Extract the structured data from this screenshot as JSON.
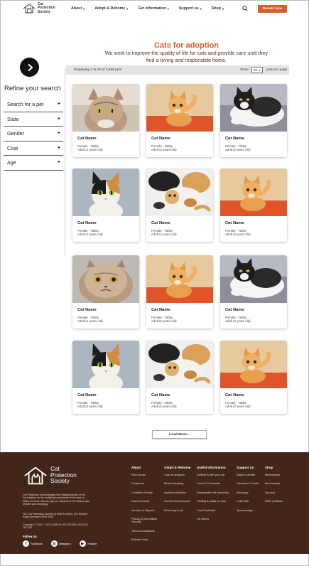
{
  "header": {
    "logo_lines": [
      "Cat",
      "Protection",
      "Society"
    ],
    "nav": [
      {
        "label": "About"
      },
      {
        "label": "Adopt & Rehome"
      },
      {
        "label": "Get information"
      },
      {
        "label": "Support us"
      },
      {
        "label": "Shop"
      }
    ],
    "search_icon": "search-icon",
    "donate_label": "Donate now"
  },
  "page": {
    "title": "Cats for adoption",
    "subtitle": "We work to improve the quality of life for cats and provide care until they find a loving and responsible home."
  },
  "sidebar": {
    "refine_title": "Refine your search",
    "filters": [
      {
        "label": "Search for a pet",
        "icon": "plus-icon"
      },
      {
        "label": "State",
        "icon": "plus-icon"
      },
      {
        "label": "Gender",
        "icon": "plus-icon"
      },
      {
        "label": "Coat",
        "icon": "plus-icon"
      },
      {
        "label": "Age",
        "icon": "plus-icon"
      }
    ]
  },
  "results": {
    "count_text": "Displaying 1 to 20 of 3,959 pets",
    "show_label": "Show",
    "show_value": "20",
    "per_page_label": "pets per page"
  },
  "pets": [
    {
      "name": "Cat Name",
      "gender_coat": "Female - Tabby",
      "age": "Adult (2 years old)",
      "photo": "tabby"
    },
    {
      "name": "Cat Name",
      "gender_coat": "Female - Tabby",
      "age": "Adult (2 years old)",
      "photo": "kitten-orange"
    },
    {
      "name": "Cat Name",
      "gender_coat": "Female - Tabby",
      "age": "Adult (2 years old)",
      "photo": "black-white"
    },
    {
      "name": "Cat Name",
      "gender_coat": "Female - Tabby",
      "age": "Adult (2 years old)",
      "photo": "calico"
    },
    {
      "name": "Cat Name",
      "gender_coat": "Female - Tabby",
      "age": "Adult (2 years old)",
      "photo": "playful"
    },
    {
      "name": "Cat Name",
      "gender_coat": "Female - Tabby",
      "age": "Adult (2 years old)",
      "photo": "kitten-orange"
    },
    {
      "name": "Cat Name",
      "gender_coat": "Female - Tabby",
      "age": "Adult (2 years old)",
      "photo": "persian"
    },
    {
      "name": "Cat Name",
      "gender_coat": "Female - Tabby",
      "age": "Adult (2 years old)",
      "photo": "kitten-orange"
    },
    {
      "name": "Cat Name",
      "gender_coat": "Female - Tabby",
      "age": "Adult (2 years old)",
      "photo": "black-white"
    },
    {
      "name": "Cat Name",
      "gender_coat": "Female - Tabby",
      "age": "Adult (2 years old)",
      "photo": "calico"
    },
    {
      "name": "Cat Name",
      "gender_coat": "Female - Tabby",
      "age": "Adult (2 years old)",
      "photo": "playful"
    },
    {
      "name": "Cat Name",
      "gender_coat": "Female - Tabby",
      "age": "Adult (2 years old)",
      "photo": "kitten-orange"
    }
  ],
  "load_more_label": "Load More...",
  "footer": {
    "logo_lines": [
      "Cat",
      "Protection",
      "Society"
    ],
    "acknowledgement": "Cat Protection acknowledges the Gadigal people of the Eora Nation as the traditional custodians of the land on which we work, and we pay our respects to the Elders past, present and emerging.",
    "registration": "The Cat Protection Society of NSW Limited | 103 Enmore Road Newtown NSW 2042",
    "copyright": "Copyright © 2001 - 2023 | ABN 61 000 153 025 | ACN 611 767 029",
    "follow_label": "Follow Us",
    "social": [
      {
        "label": "Facebook",
        "icon": "facebook-icon",
        "glyph": "f"
      },
      {
        "label": "Instagram",
        "icon": "instagram-icon",
        "glyph": "◎"
      },
      {
        "label": "Youtube",
        "icon": "youtube-icon",
        "glyph": "▶"
      }
    ],
    "columns": [
      {
        "title": "About",
        "links": [
          "Who we are",
          "Contact us",
          "Condition of entry",
          "News & events",
          "Archives & Reports",
          "Privacy & Information Security",
          "Terms & Conditions",
          "Refund Policy"
        ]
      },
      {
        "title": "Adopt & Rehome",
        "links": [
          "Cats for adoption",
          "Before Adopting",
          "Apply for Adoption",
          "Forever homes found",
          "Rehoming a cat"
        ]
      },
      {
        "title": "Useful Information",
        "links": [
          "Settling in with your cat",
          "Covid-19 & Animals",
          "Responsible cat ownership",
          "Renting & strata for cats",
          "Care Factsheet",
          "Vet clinics"
        ]
      },
      {
        "title": "Support us",
        "links": [
          "Ways to donate",
          "Volunteer & Foster",
          "Advocacy",
          "Craft Club",
          "Sponsorships"
        ]
      },
      {
        "title": "Shop",
        "links": [
          "Membership",
          "Merchandise",
          "Op shop",
          "Other products"
        ]
      }
    ]
  },
  "colors": {
    "accent": "#d6602a",
    "footer_bg": "#42261a",
    "subtitle": "#5a2b17"
  }
}
